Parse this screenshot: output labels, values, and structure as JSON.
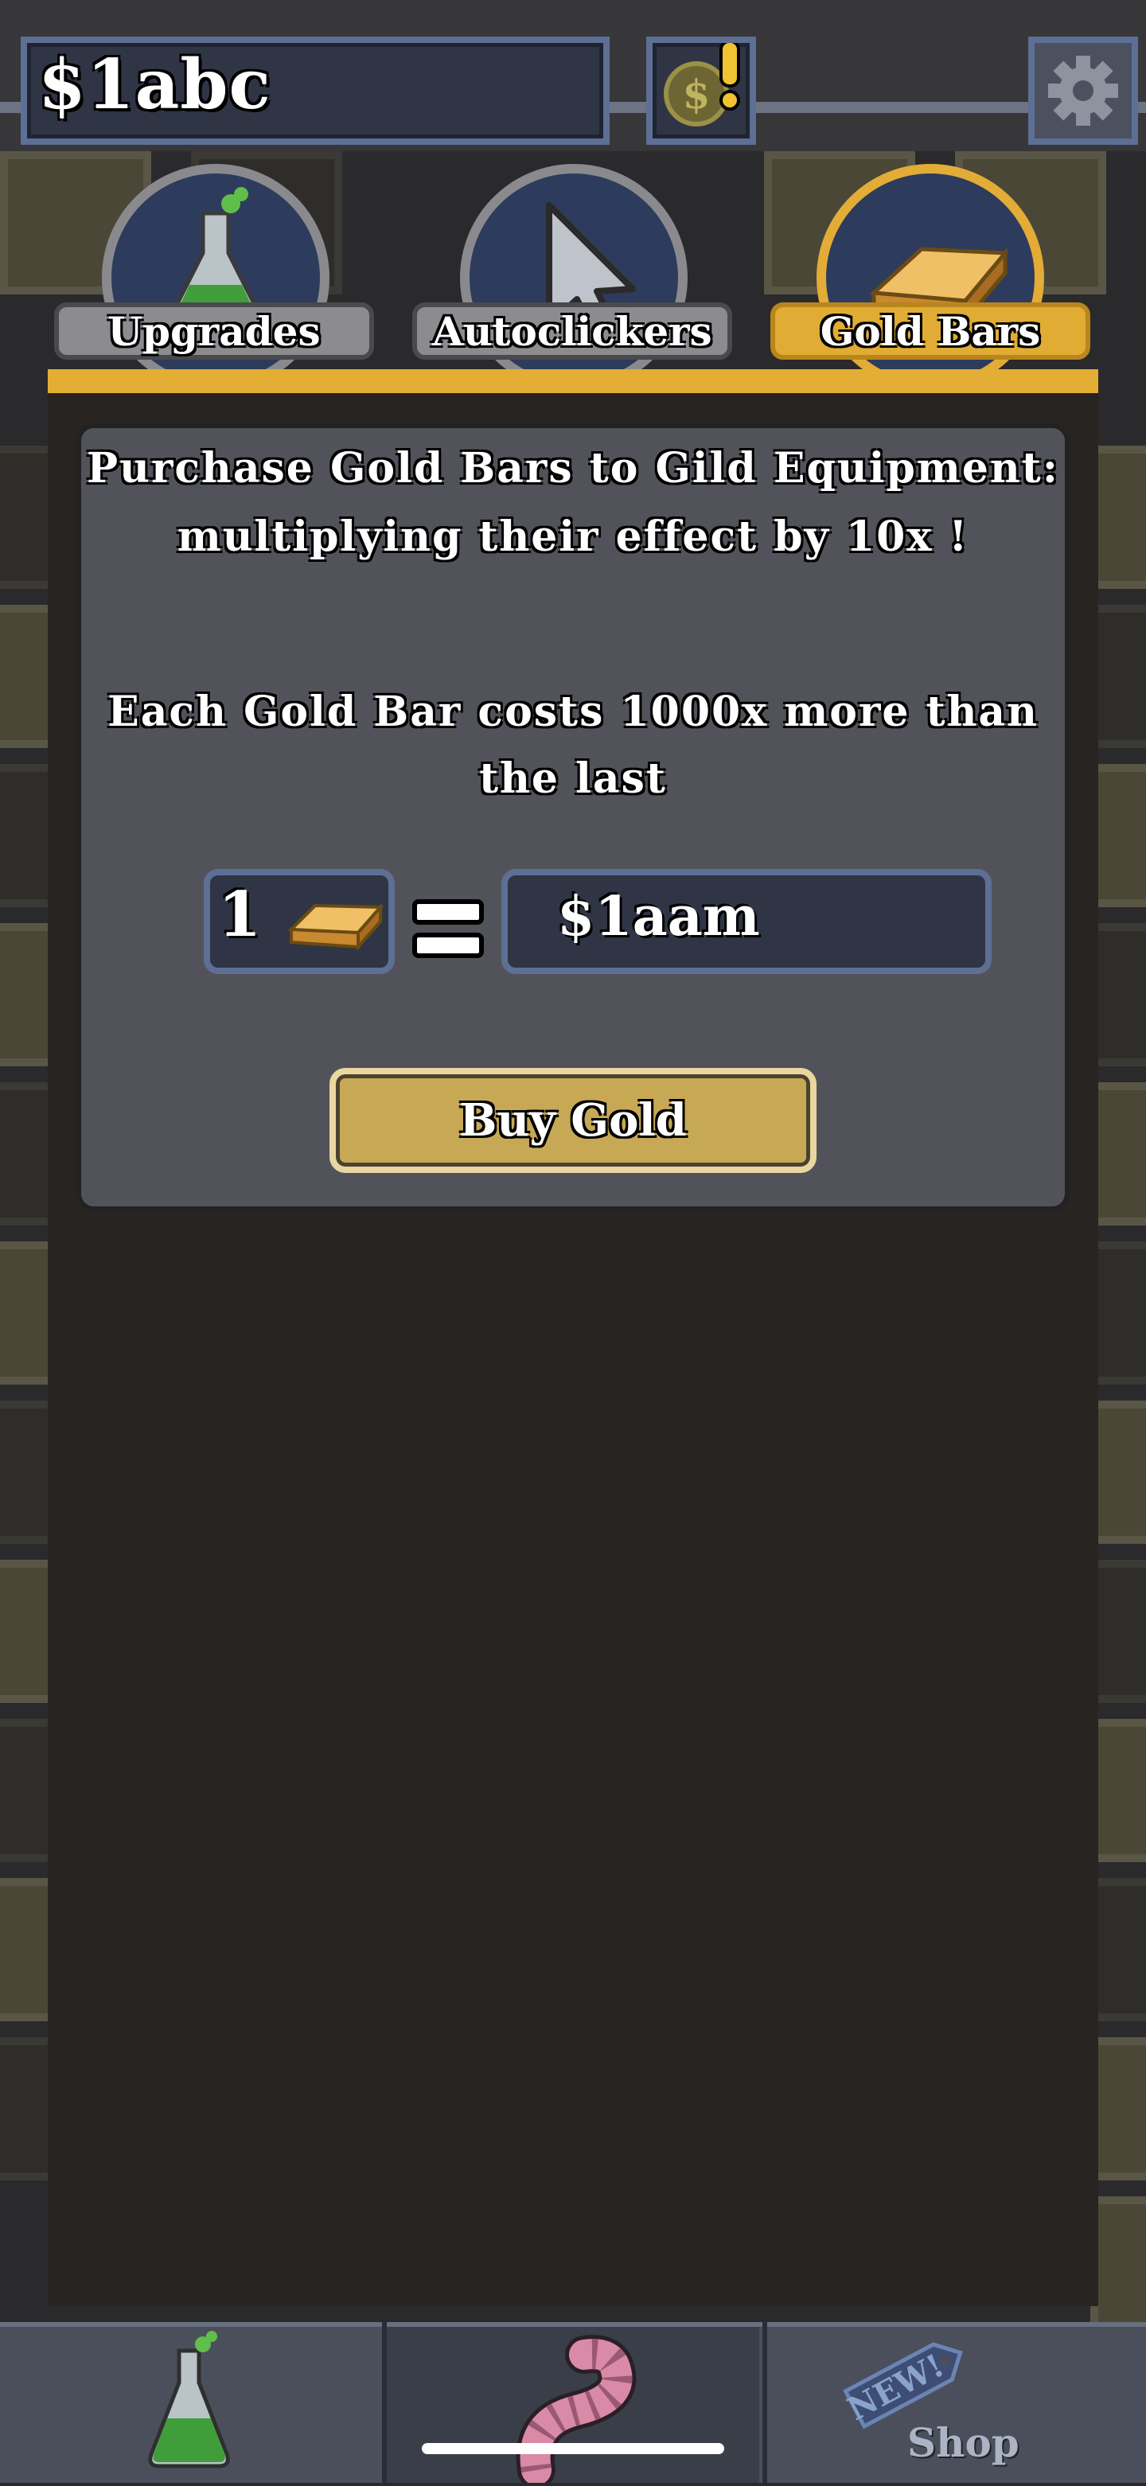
{
  "header": {
    "money": "$1abc"
  },
  "tabs": [
    {
      "label": "Upgrades",
      "icon": "flask-icon",
      "active": false
    },
    {
      "label": "Autoclickers",
      "icon": "cursor-icon",
      "active": false
    },
    {
      "label": "Gold Bars",
      "icon": "gold-bar-icon",
      "active": true
    }
  ],
  "gold_panel": {
    "description_line1": "Purchase Gold Bars to Gild Equipment:",
    "description_line2": "multiplying their effect by 10x !",
    "cost_line1": "Each Gold Bar costs 1000x more than",
    "cost_line2": "the last",
    "quantity": "1",
    "price": "$1aam",
    "buy_label": "Buy Gold"
  },
  "bottom_nav": {
    "shop_label": "Shop",
    "shop_badge": "NEW!"
  },
  "colors": {
    "accent": "#e4ad33",
    "panel": "#52535a",
    "frame": "#5d6f94"
  }
}
